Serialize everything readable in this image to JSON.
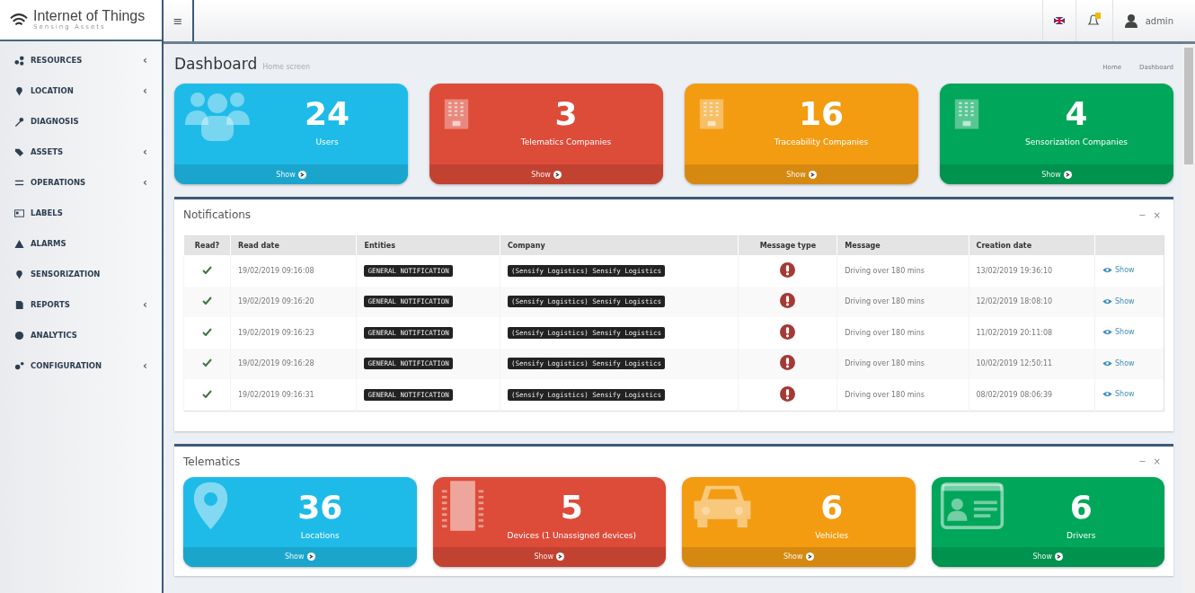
{
  "header": {
    "logo_title": "Internet of Things",
    "logo_subtitle": "Sensing Assets",
    "menu_toggle": "≡",
    "user": "admin",
    "notifications_badge": true
  },
  "sidebar": {
    "items": [
      {
        "label": "RESOURCES",
        "kind": "share",
        "arrow": "‹"
      },
      {
        "label": "LOCATION",
        "kind": "pin",
        "arrow": "‹"
      },
      {
        "label": "DIAGNOSIS",
        "kind": "wrench"
      },
      {
        "label": "ASSETS",
        "kind": "tag",
        "arrow": "‹"
      },
      {
        "label": "OPERATIONS",
        "kind": "exchange",
        "arrow": "‹"
      },
      {
        "label": "LABELS",
        "kind": "card"
      },
      {
        "label": "ALARMS",
        "kind": "warning"
      },
      {
        "label": "SENSORIZATION",
        "kind": "pin"
      },
      {
        "label": "REPORTS",
        "kind": "file",
        "arrow": "‹"
      },
      {
        "label": "ANALYTICS",
        "kind": "pie"
      },
      {
        "label": "CONFIGURATION",
        "kind": "gears",
        "arrow": "‹"
      }
    ]
  },
  "page": {
    "title": "Dashboard",
    "subtitle": "Home screen",
    "breadcrumb": [
      "Home",
      "Dashboard"
    ]
  },
  "stats": [
    {
      "value": "24",
      "label": "Users",
      "link": "Show",
      "color": "#1ebbe8",
      "kind": "users"
    },
    {
      "value": "3",
      "label": "Telematics Companies",
      "link": "Show",
      "color": "#dd4b39",
      "kind": "building"
    },
    {
      "value": "16",
      "label": "Traceability Companies",
      "link": "Show",
      "color": "#f39c12",
      "kind": "building"
    },
    {
      "value": "4",
      "label": "Sensorization Companies",
      "link": "Show",
      "color": "#00a65a",
      "kind": "building"
    }
  ],
  "notifications": {
    "title": "Notifications",
    "tools": [
      "−",
      "×"
    ],
    "columns": [
      "Read?",
      "Read date",
      "Entities",
      "Company",
      "Message type",
      "Message",
      "Creation date"
    ],
    "rows": [
      {
        "read": true,
        "read_date": "19/02/2019 09:16:08",
        "entity": "GENERAL NOTIFICATION",
        "company": "(Sensify Logistics) Sensify Logistics",
        "kind": "alert",
        "message": "Driving over 180 mins",
        "created": "13/02/2019 19:36:10",
        "action": "Show"
      },
      {
        "read": true,
        "read_date": "19/02/2019 09:16:20",
        "entity": "GENERAL NOTIFICATION",
        "company": "(Sensify Logistics) Sensify Logistics",
        "kind": "alert",
        "message": "Driving over 180 mins",
        "created": "12/02/2019 18:08:10",
        "action": "Show"
      },
      {
        "read": true,
        "read_date": "19/02/2019 09:16:23",
        "entity": "GENERAL NOTIFICATION",
        "company": "(Sensify Logistics) Sensify Logistics",
        "kind": "alert",
        "message": "Driving over 180 mins",
        "created": "11/02/2019 20:11:08",
        "action": "Show"
      },
      {
        "read": true,
        "read_date": "19/02/2019 09:16:28",
        "entity": "GENERAL NOTIFICATION",
        "company": "(Sensify Logistics) Sensify Logistics",
        "kind": "alert",
        "message": "Driving over 180 mins",
        "created": "10/02/2019 12:50:11",
        "action": "Show"
      },
      {
        "read": true,
        "read_date": "19/02/2019 09:16:31",
        "entity": "GENERAL NOTIFICATION",
        "company": "(Sensify Logistics) Sensify Logistics",
        "kind": "alert",
        "message": "Driving over 180 mins",
        "created": "08/02/2019 08:06:39",
        "action": "Show"
      }
    ]
  },
  "telematics": {
    "title": "Telematics",
    "tools": [
      "−",
      "×"
    ],
    "stats": [
      {
        "value": "36",
        "label": "Locations",
        "link": "Show",
        "color": "#1ebbe8",
        "kind": "pin"
      },
      {
        "value": "5",
        "label": "Devices (1 Unassigned devices)",
        "link": "Show",
        "color": "#dd4b39",
        "kind": "chip"
      },
      {
        "value": "6",
        "label": "Vehicles",
        "link": "Show",
        "color": "#f39c12",
        "kind": "car"
      },
      {
        "value": "6",
        "label": "Drivers",
        "link": "Show",
        "color": "#00a65a",
        "kind": "idcard"
      }
    ]
  }
}
